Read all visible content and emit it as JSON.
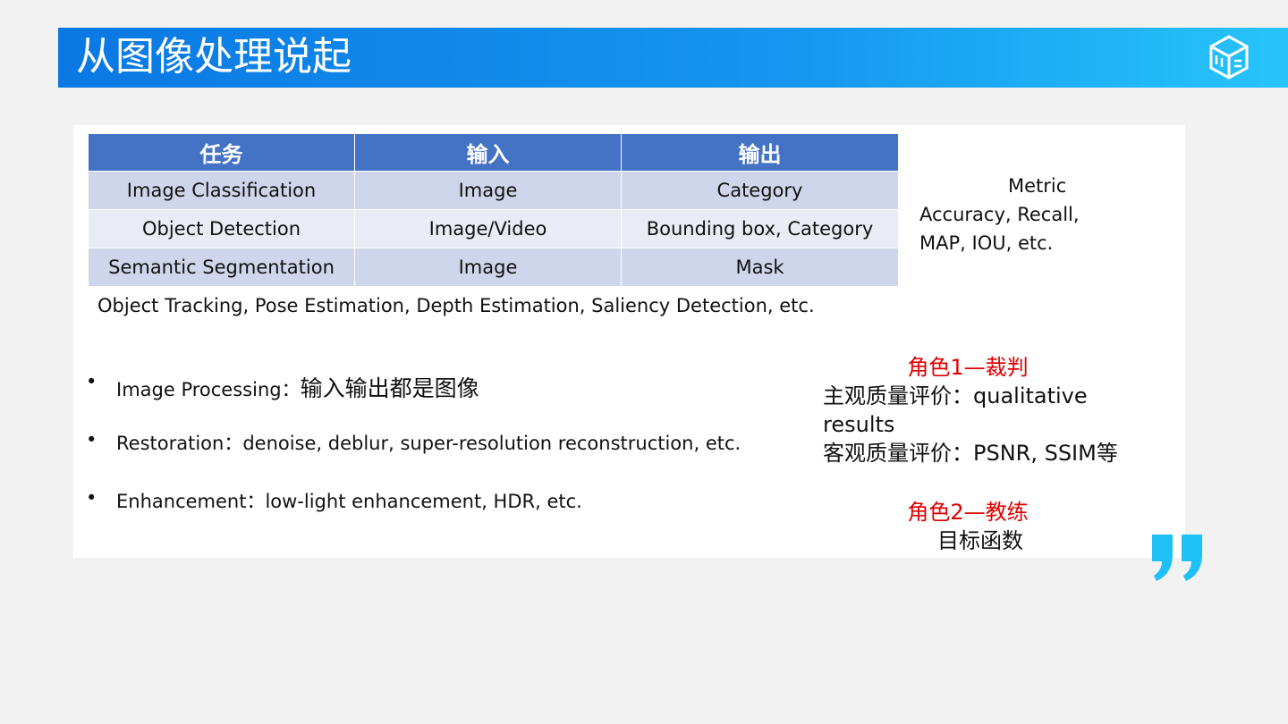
{
  "header": {
    "title": "从图像处理说起",
    "logo_icon": "cube-logo-icon"
  },
  "table": {
    "headers": [
      "任务",
      "输入",
      "输出"
    ],
    "rows": [
      [
        "Image Classification",
        "Image",
        "Category"
      ],
      [
        "Object Detection",
        "Image/Video",
        "Bounding box, Category"
      ],
      [
        "Semantic Segmentation",
        "Image",
        "Mask"
      ]
    ]
  },
  "more_tasks": "Object Tracking, Pose Estimation, Depth Estimation, Saliency Detection, etc.",
  "metric": {
    "title": "Metric",
    "line1": "Accuracy, Recall,",
    "line2": "MAP, IOU, etc."
  },
  "bullets": [
    {
      "en": "Image Processing：",
      "cn": "输入输出都是图像"
    },
    {
      "en": "Restoration：denoise, deblur, super-resolution reconstruction, etc.",
      "cn": ""
    },
    {
      "en": "Enhancement：low-light enhancement, HDR, etc.",
      "cn": ""
    }
  ],
  "roles": {
    "role1": "角色1—裁判",
    "subjective": "主观质量评价：qualitative results",
    "objective": "客观质量评价：PSNR, SSIM等",
    "role2": "角色2—教练",
    "objective_fn": "目标函数"
  },
  "colors": {
    "header": "#4472c4",
    "row_odd": "#cfd5ea",
    "row_even": "#e9ebf5",
    "accent": "#e00000",
    "quote": "#1ec0f8"
  }
}
